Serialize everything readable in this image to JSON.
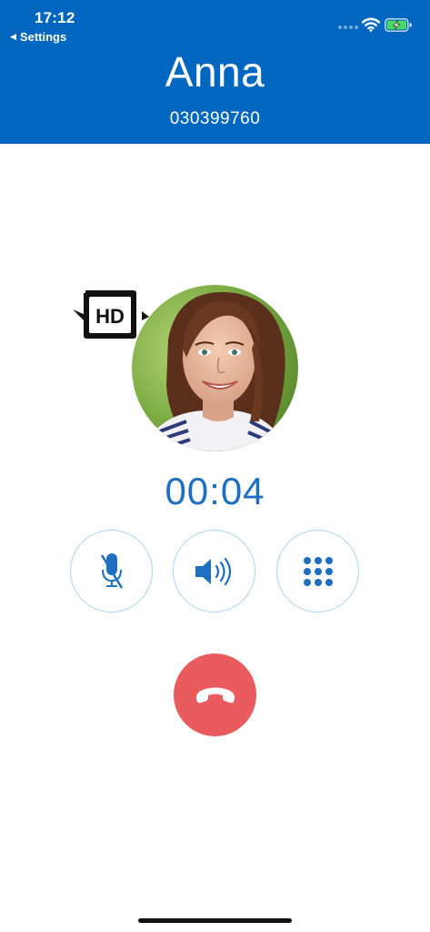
{
  "status_bar": {
    "time": "17:12",
    "back_label": "Settings"
  },
  "call": {
    "caller_name": "Anna",
    "caller_number": "030399760",
    "duration": "00:04",
    "hd_badge": "HD"
  },
  "controls": {
    "mute_icon": "microphone-off-icon",
    "speaker_icon": "speaker-icon",
    "keypad_icon": "dialpad-icon",
    "hangup_icon": "phone-hangup-icon"
  },
  "colors": {
    "header": "#0067c0",
    "accent": "#1e6fc0",
    "button_border": "#a9d4f0",
    "hangup": "#ea5b5e",
    "battery": "#4cd964"
  }
}
